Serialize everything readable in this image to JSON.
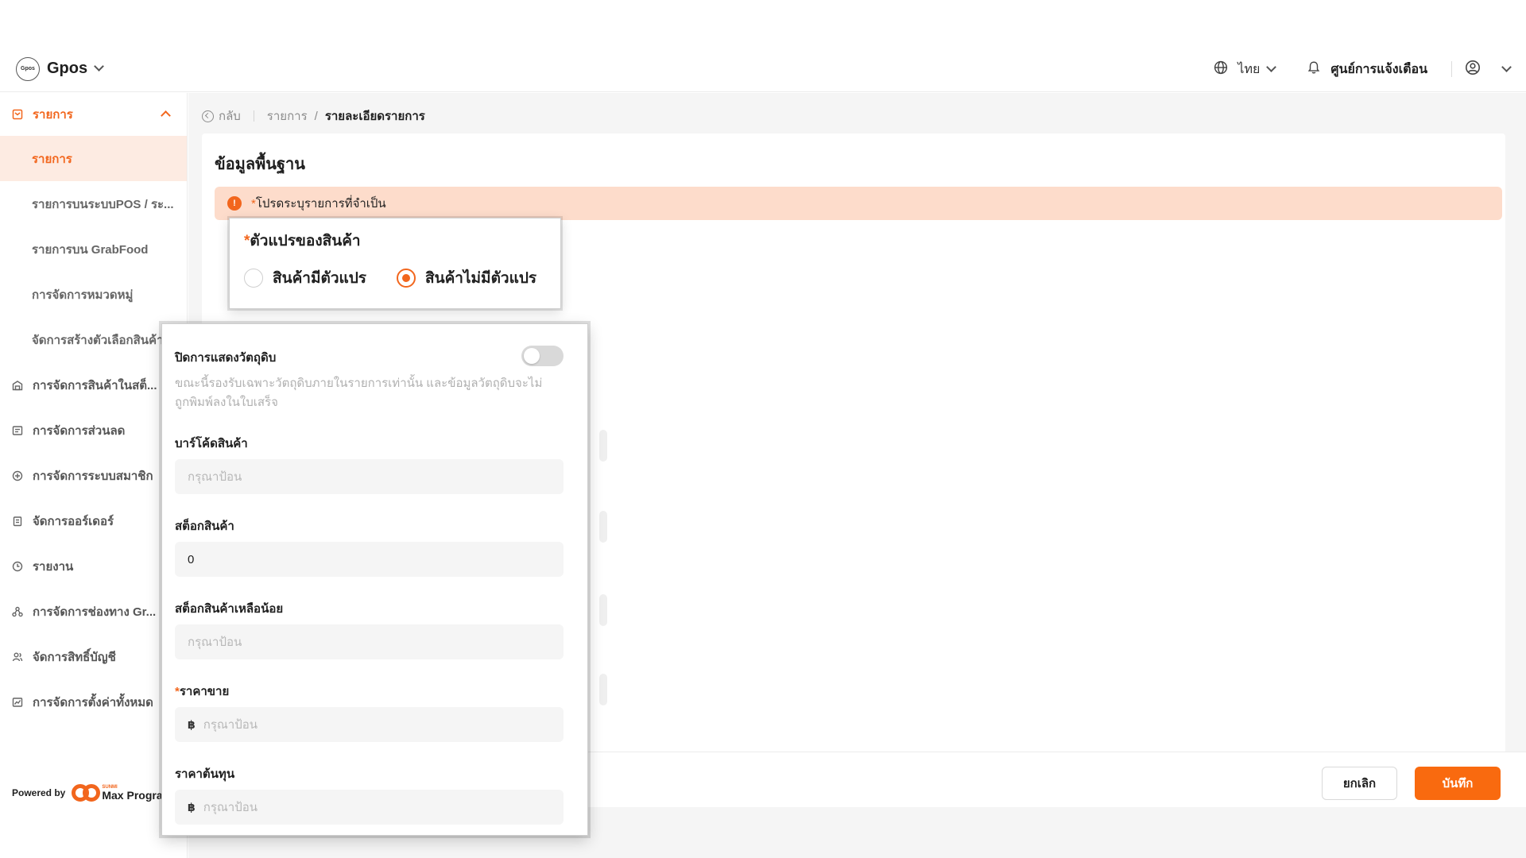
{
  "header": {
    "brand_logo_text": "Gpos",
    "brand_name": "Gpos",
    "language": "ไทย",
    "notification_center": "ศูนย์การแจ้งเตือน"
  },
  "sidebar": {
    "group_label": "รายการ",
    "sub_items": [
      {
        "label": "รายการ"
      },
      {
        "label": "รายการบนระบบPOS / ระ..."
      },
      {
        "label": "รายการบน GrabFood"
      },
      {
        "label": "การจัดการหมวดหมู่"
      },
      {
        "label": "จัดการสร้างตัวเลือกสินค้า"
      }
    ],
    "items": [
      {
        "label": "การจัดการสินค้าในสต็..."
      },
      {
        "label": "การจัดการส่วนลด"
      },
      {
        "label": "การจัดการระบบสมาชิก"
      },
      {
        "label": "จัดการออร์เดอร์"
      },
      {
        "label": "รายงาน"
      },
      {
        "label": "การจัดการช่องทาง Gr..."
      },
      {
        "label": "จัดการสิทธิ์บัญชี"
      },
      {
        "label": "การจัดการตั้งค่าทั้งหมด"
      }
    ],
    "powered_by": "Powered by",
    "partner_small": "SUNMI",
    "partner_big": "Max Progra"
  },
  "breadcrumb": {
    "back": "กลับ",
    "parent": "รายการ",
    "separator": "/",
    "current": "รายละเอียดรายการ"
  },
  "main": {
    "section_title": "ข้อมูลพื้นฐาน",
    "alert": {
      "required_mark": "*",
      "text": "โปรดระบุรายการที่จำเป็น"
    }
  },
  "variant": {
    "required_mark": "*",
    "title": "ตัวแปรของสินค้า",
    "options": [
      {
        "label": "สินค้ามีตัวแปร",
        "checked": false
      },
      {
        "label": "สินค้าไม่มีตัวแปร",
        "checked": true
      }
    ]
  },
  "details": {
    "hide_material_label": "ปิดการแสดงวัตถุดิบ",
    "hide_material_on": false,
    "hint": "ขณะนี้รองรับเฉพาะวัตถุดิบภายในรายการเท่านั้น และข้อมูลวัตถุดิบจะไม่ถูกพิมพ์ลงในใบเสร็จ",
    "barcode_label": "บาร์โค้ดสินค้า",
    "barcode_placeholder": "กรุณาป้อน",
    "stock_label": "สต็อกสินค้า",
    "stock_value": "0",
    "low_stock_label": "สต็อกสินค้าเหลือน้อย",
    "low_stock_placeholder": "กรุณาป้อน",
    "price_required_mark": "*",
    "price_label": "ราคาขาย",
    "price_currency": "฿",
    "price_placeholder": "กรุณาป้อน",
    "cost_label": "ราคาต้นทุน",
    "cost_currency": "฿",
    "cost_placeholder": "กรุณาป้อน"
  },
  "footer": {
    "cancel": "ยกเลิก",
    "save": "บันทึก"
  },
  "colors": {
    "accent": "#f2661d",
    "accent_button": "#f96a0f",
    "alert_bg": "#fddccb",
    "active_nav_bg": "#fdebe2"
  }
}
